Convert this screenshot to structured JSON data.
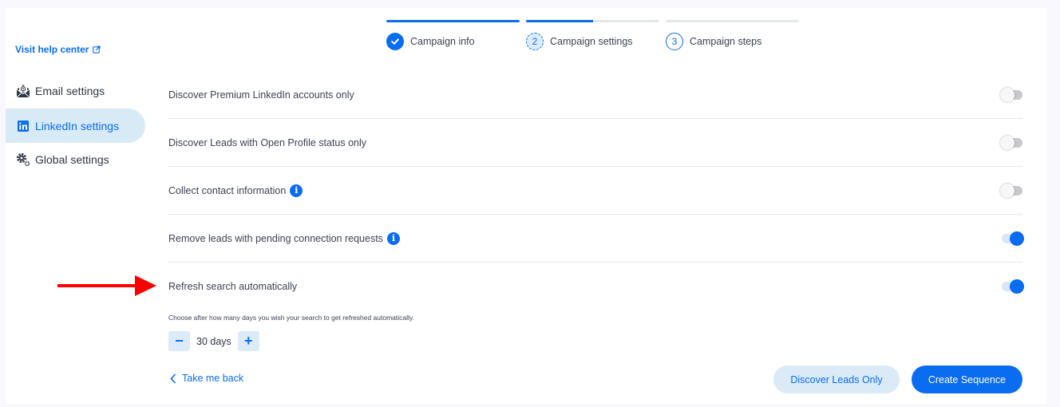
{
  "sidebar": {
    "help_link": "Visit help center",
    "items": [
      {
        "label": "Email settings",
        "icon": "email-envelope-icon",
        "active": false
      },
      {
        "label": "LinkedIn settings",
        "icon": "linkedin-icon",
        "active": true
      },
      {
        "label": "Global settings",
        "icon": "gears-icon",
        "active": false
      }
    ]
  },
  "stepper": {
    "steps": [
      {
        "number": "1",
        "label": "Campaign info",
        "status": "done",
        "progress": 1.0
      },
      {
        "number": "2",
        "label": "Campaign settings",
        "status": "current",
        "progress": 0.5
      },
      {
        "number": "3",
        "label": "Campaign steps",
        "status": "todo",
        "progress": 0.0
      }
    ]
  },
  "settings": [
    {
      "label": "Discover Premium LinkedIn accounts only",
      "info": false,
      "enabled": false
    },
    {
      "label": "Discover Leads with Open Profile status only",
      "info": false,
      "enabled": false
    },
    {
      "label": "Collect contact information",
      "info": true,
      "enabled": false
    },
    {
      "label": "Remove leads with pending connection requests",
      "info": true,
      "enabled": true
    },
    {
      "label": "Refresh search automatically",
      "info": false,
      "enabled": true
    }
  ],
  "refresh": {
    "hint": "Choose after how many days you wish your search to get refreshed automatically.",
    "value": "30 days",
    "decrement": "−",
    "increment": "+"
  },
  "footer": {
    "back_label": "Take me back",
    "secondary_label": "Discover Leads Only",
    "primary_label": "Create Sequence"
  },
  "colors": {
    "accent": "#0a6cf0",
    "annotation_arrow": "#ff0000"
  }
}
